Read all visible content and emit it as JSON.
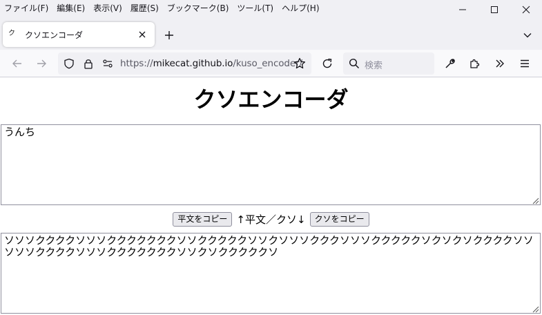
{
  "menubar": {
    "items": [
      "ファイル(F)",
      "編集(E)",
      "表示(V)",
      "履歴(S)",
      "ブックマーク(B)",
      "ツール(T)",
      "ヘルプ(H)"
    ]
  },
  "window_controls": {
    "minimize_icon": "minimize-icon",
    "maximize_icon": "maximize-icon",
    "close_icon": "close-icon"
  },
  "tab": {
    "favicon_text": "ク",
    "title": "クソエンコーダ"
  },
  "navbar": {
    "url_prefix": "https://",
    "url_host": "mikecat.github.io",
    "url_path": "/kuso_encoder/",
    "search_placeholder": "検索"
  },
  "page": {
    "title": "クソエンコーダ",
    "plaintext_value": "うんち",
    "copy_plain_label": "平文をコピー",
    "direction_text": "↑平文／クソ↓",
    "copy_kuso_label": "クソをコピー",
    "kuso_value": "ソソソククククソソソクククククククソソクククククソソクソソソクククソソソクククククソクソクソククククソソソソソククククソソソクククククククソソクソクククククソ"
  },
  "colors": {
    "chrome_bg": "#f0f0f4",
    "toolbar_bg": "#f9f9fb",
    "accent": "#15141a"
  }
}
